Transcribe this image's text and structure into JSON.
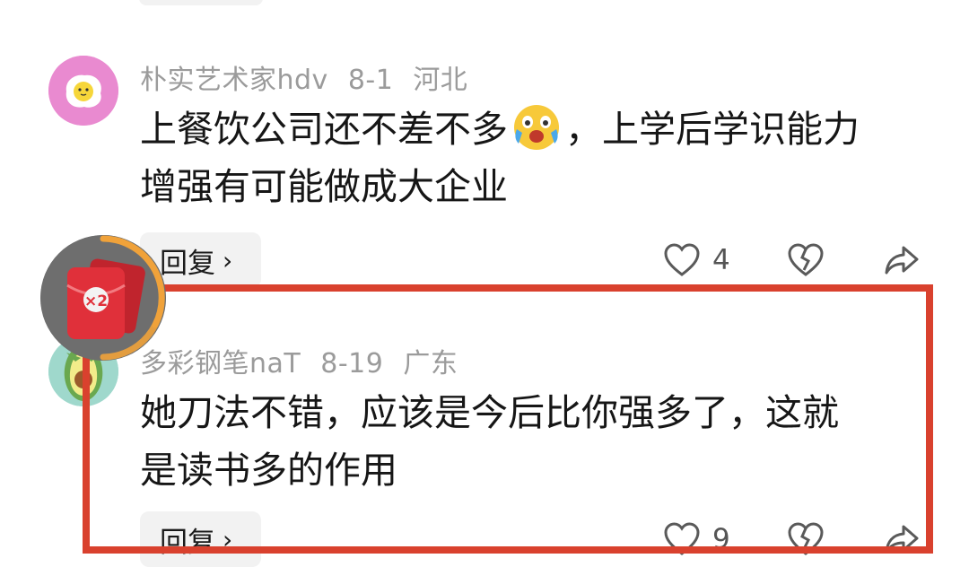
{
  "comments": [
    {
      "username": "朴实艺术家hdv",
      "date": "8-1",
      "location": "河北",
      "text_line1": "上餐饮公司还不差不多",
      "text_line1_after": "，上学后学识能力",
      "text_line2": "增强有可能做成大企业",
      "reply_label": "回复",
      "like_count": "4",
      "avatar_icon": "fried-egg-avatar"
    },
    {
      "username": "多彩钢笔naT",
      "date": "8-19",
      "location": "广东",
      "text_line1": "她刀法不错，应该是今后比你强多了，这就",
      "text_line2": "是读书多的作用",
      "reply_label": "回复",
      "like_count": "9",
      "avatar_icon": "avocado-avatar"
    }
  ],
  "floating_badge": {
    "value": "×2",
    "icon": "red-packet-icon"
  },
  "colors": {
    "highlight": "#d9412e",
    "meta_text": "#9b9b9b",
    "body_text": "#161616"
  }
}
